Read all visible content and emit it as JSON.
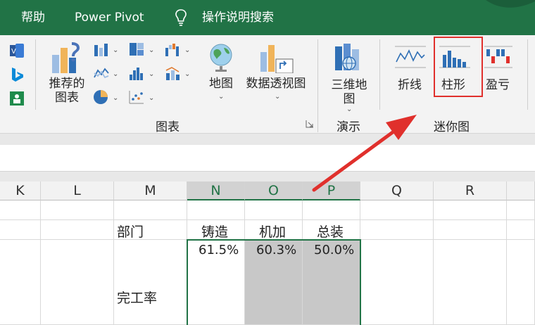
{
  "tabs": {
    "help": "帮助",
    "power_pivot": "Power Pivot",
    "tell_me": "操作说明搜索"
  },
  "ribbon": {
    "recommended_charts": "推荐的\n图表",
    "maps": "地图",
    "pivot_chart": "数据透视图",
    "three_d_map": "三维地\n图",
    "sparkline_line": "折线",
    "sparkline_column": "柱形",
    "sparkline_winloss": "盈亏",
    "group_charts": "图表",
    "group_tours": "演示",
    "group_sparklines": "迷你图"
  },
  "columns": [
    "K",
    "L",
    "M",
    "N",
    "O",
    "P",
    "Q",
    "R"
  ],
  "sheet": {
    "dept_label": "部门",
    "departments": [
      "铸造",
      "机加",
      "总装"
    ],
    "rate_label": "完工率",
    "rates": [
      "61.5%",
      "60.3%",
      "50.0%"
    ]
  },
  "colors": {
    "accent": "#217346",
    "annotation": "#e0302c",
    "selection_fill": "#c8c8c8"
  }
}
